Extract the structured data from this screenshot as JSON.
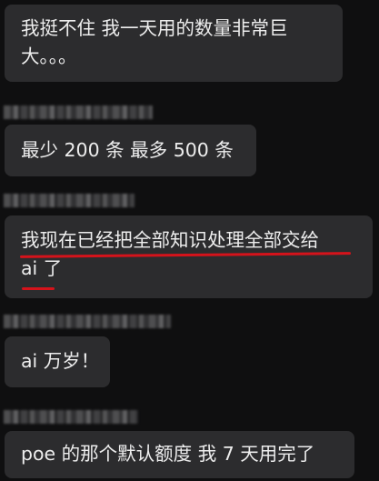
{
  "messages": [
    {
      "lines": [
        "我挺不住 我一天用的数量非常巨",
        "大。。。"
      ]
    },
    {
      "lines": [
        "最少 200 条 最多 500 条"
      ]
    },
    {
      "lines": [
        "我现在已经把全部知识处理全部交给",
        "ai 了"
      ]
    },
    {
      "lines": [
        "ai 万岁！"
      ]
    },
    {
      "lines": [
        "poe 的那个默认额度 我 7 天用完了"
      ]
    }
  ],
  "highlight_color": "#d5131b"
}
